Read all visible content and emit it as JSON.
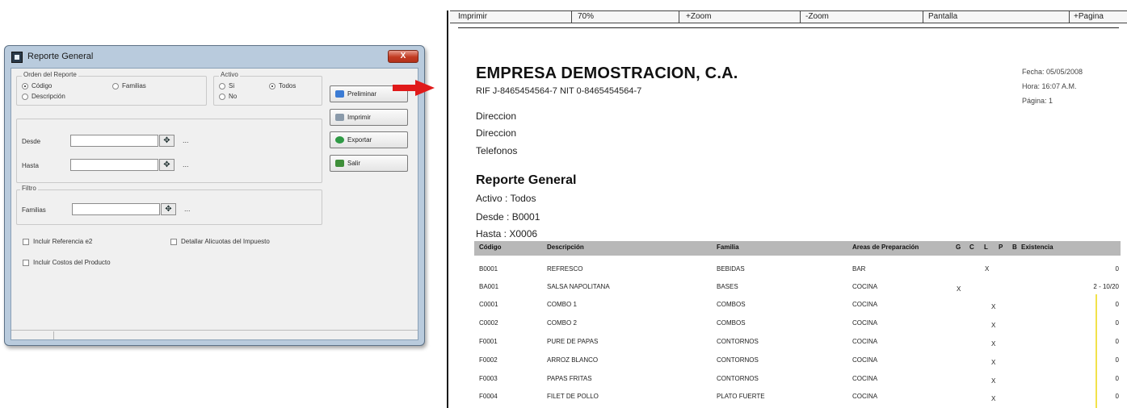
{
  "dialog": {
    "title": "Reporte General",
    "close_label": "X",
    "orden": {
      "legend": "Orden del Reporte",
      "options": [
        {
          "label": "Código",
          "selected": true
        },
        {
          "label": "Familias",
          "selected": false
        },
        {
          "label": "Descripción",
          "selected": false
        }
      ]
    },
    "activo": {
      "legend": "Activo",
      "options": [
        {
          "label": "Si",
          "selected": false
        },
        {
          "label": "Todos",
          "selected": true
        },
        {
          "label": "No",
          "selected": false
        }
      ]
    },
    "desde_label": "Desde",
    "hasta_label": "Hasta",
    "desde_value": "",
    "hasta_value": "",
    "ellipsis": "...",
    "filtros": {
      "legend": "Filtro",
      "familias_label": "Familias",
      "familias_value": ""
    },
    "checks": [
      {
        "label": "Incluir Referencia e2",
        "checked": false
      },
      {
        "label": "Detallar Alicuotas del Impuesto",
        "checked": false
      },
      {
        "label": "Incluir Costos del Producto",
        "checked": false
      }
    ],
    "buttons": {
      "preview": "Preliminar",
      "print": "Imprimir",
      "export": "Exportar",
      "exit": "Salir"
    }
  },
  "viewer": {
    "toolbar": [
      "Imprimir",
      "70%",
      "+Zoom",
      "-Zoom",
      "Pantalla",
      "+Pagina"
    ],
    "company": "EMPRESA DEMOSTRACION, C.A.",
    "rif_line": "RIF  J-8465454564-7      NIT   0-8465454564-7",
    "address1": "Direccion",
    "address2": "Direccion",
    "phone": "Telefonos",
    "fecha": "Fecha: 05/05/2008",
    "hora": "Hora: 16:07 A.M.",
    "pagina": "Página: 1",
    "report_title": "Reporte General",
    "activo_param": "Activo :  Todos",
    "desde_param": "Desde :   B0001",
    "hasta_param": "Hasta :   X0006",
    "columns": [
      "Código",
      "Descripción",
      "Familia",
      "Areas de Preparación",
      "G",
      "C",
      "L",
      "P",
      "B",
      "Existencia"
    ],
    "rows": [
      {
        "codigo": "B0001",
        "desc": "REFRESCO",
        "familia": "BEBIDAS",
        "area": "BAR",
        "mark1": "",
        "mark2": "X",
        "exist": "0"
      },
      {
        "codigo": "BA001",
        "desc": "SALSA NAPOLITANA",
        "familia": "BASES",
        "area": "COCINA",
        "mark1": "X",
        "mark2": "",
        "exist": "2 - 10/20"
      },
      {
        "codigo": "C0001",
        "desc": "COMBO 1",
        "familia": "COMBOS",
        "area": "COCINA",
        "mark1": "",
        "mark2": "X",
        "exist": "0"
      },
      {
        "codigo": "C0002",
        "desc": "COMBO 2",
        "familia": "COMBOS",
        "area": "COCINA",
        "mark1": "",
        "mark2": "X",
        "exist": "0"
      },
      {
        "codigo": "F0001",
        "desc": "PURE DE PAPAS",
        "familia": "CONTORNOS",
        "area": "COCINA",
        "mark1": "",
        "mark2": "X",
        "exist": "0"
      },
      {
        "codigo": "F0002",
        "desc": "ARROZ BLANCO",
        "familia": "CONTORNOS",
        "area": "COCINA",
        "mark1": "",
        "mark2": "X",
        "exist": "0"
      },
      {
        "codigo": "F0003",
        "desc": "PAPAS FRITAS",
        "familia": "CONTORNOS",
        "area": "COCINA",
        "mark1": "",
        "mark2": "X",
        "exist": "0"
      },
      {
        "codigo": "F0004",
        "desc": "FILET DE POLLO",
        "familia": "PLATO FUERTE",
        "area": "COCINA",
        "mark1": "",
        "mark2": "X",
        "exist": "0"
      }
    ]
  },
  "colors": {
    "arrow": "#e01a1a",
    "dialog_frame": "#b9cbdd",
    "header_band": "#b8b8b8",
    "highlight_line": "#f2e24a"
  }
}
